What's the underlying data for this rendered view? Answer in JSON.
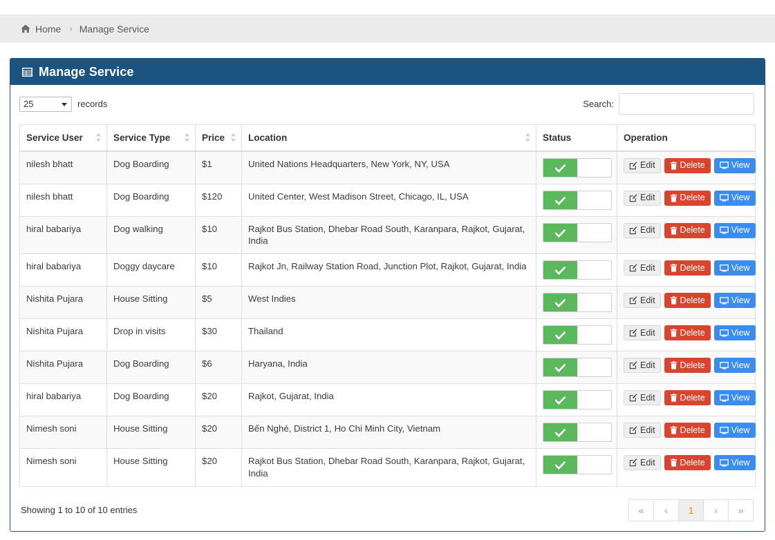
{
  "breadcrumb": {
    "home_label": "Home",
    "separator": "›",
    "current_label": "Manage Service",
    "home_icon": "home-icon"
  },
  "panel": {
    "title": "Manage Service",
    "icon": "table-list-icon",
    "header_color": "#1b5480"
  },
  "controls": {
    "length_value": "25",
    "length_options": [
      "25"
    ],
    "length_suffix_label": "records",
    "search_label": "Search:",
    "search_value": "",
    "search_placeholder": ""
  },
  "table": {
    "columns": [
      {
        "label": "Service User",
        "sortable": true
      },
      {
        "label": "Service Type",
        "sortable": true
      },
      {
        "label": "Price",
        "sortable": true
      },
      {
        "label": "Location",
        "sortable": true
      },
      {
        "label": "Status",
        "sortable": false
      },
      {
        "label": "Operation",
        "sortable": false
      }
    ],
    "rows": [
      {
        "user": "nilesh bhatt",
        "type": "Dog Boarding",
        "price": "$1",
        "location": "United Nations Headquarters, New York, NY, USA",
        "status_on": true
      },
      {
        "user": "nilesh bhatt",
        "type": "Dog Boarding",
        "price": "$120",
        "location": "United Center, West Madison Street, Chicago, IL, USA",
        "status_on": true
      },
      {
        "user": "hiral babariya",
        "type": "Dog walking",
        "price": "$10",
        "location": "Rajkot Bus Station, Dhebar Road South, Karanpara, Rajkot, Gujarat, India",
        "status_on": true
      },
      {
        "user": "hiral babariya",
        "type": "Doggy daycare",
        "price": "$10",
        "location": "Rajkot Jn, Railway Station Road, Junction Plot, Rajkot, Gujarat, India",
        "status_on": true
      },
      {
        "user": "Nishita Pujara",
        "type": "House Sitting",
        "price": "$5",
        "location": "West Indies",
        "status_on": true
      },
      {
        "user": "Nishita Pujara",
        "type": "Drop in visits",
        "price": "$30",
        "location": "Thailand",
        "status_on": true
      },
      {
        "user": "Nishita Pujara",
        "type": "Dog Boarding",
        "price": "$6",
        "location": "Haryana, India",
        "status_on": true
      },
      {
        "user": "hiral babariya",
        "type": "Dog Boarding",
        "price": "$20",
        "location": "Rajkot, Gujarat, India",
        "status_on": true
      },
      {
        "user": "Nimesh soni",
        "type": "House Sitting",
        "price": "$20",
        "location": "Bến Nghé, District 1, Ho Chi Minh City, Vietnam",
        "status_on": true
      },
      {
        "user": "Nimesh soni",
        "type": "House Sitting",
        "price": "$20",
        "location": "Rajkot Bus Station, Dhebar Road South, Karanpara, Rajkot, Gujarat, India",
        "status_on": true
      }
    ]
  },
  "operations": {
    "edit_label": "Edit",
    "delete_label": "Delete",
    "view_label": "View",
    "edit_icon": "pencil-square-icon",
    "delete_icon": "trash-icon",
    "view_icon": "monitor-icon"
  },
  "footer": {
    "info": "Showing 1 to 10 of 10 entries",
    "pagination": [
      {
        "label": "«",
        "name": "pagination-first",
        "kind": "arrow",
        "active": false
      },
      {
        "label": "‹",
        "name": "pagination-previous",
        "kind": "arrow",
        "active": false
      },
      {
        "label": "1",
        "name": "pagination-page-1",
        "kind": "page",
        "active": true
      },
      {
        "label": "›",
        "name": "pagination-next",
        "kind": "arrow",
        "active": false
      },
      {
        "label": "»",
        "name": "pagination-last",
        "kind": "arrow",
        "active": false
      }
    ]
  },
  "colors": {
    "panel_header": "#1b5480",
    "toggle_on": "#5cb85c",
    "delete": "#d9442f",
    "view": "#3b8cf0",
    "edit": "#eeeeee",
    "active_page_text": "#e08a35"
  }
}
